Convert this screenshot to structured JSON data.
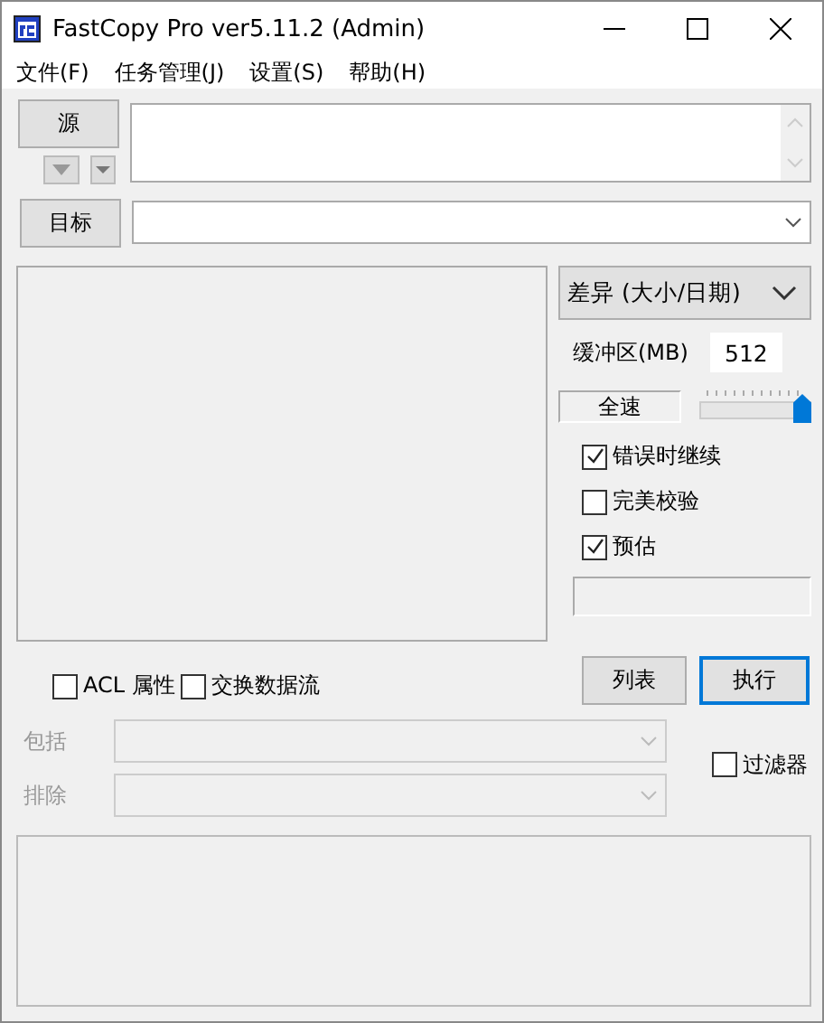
{
  "window": {
    "title": "FastCopy Pro ver5.11.2 (Admin)"
  },
  "menu": [
    "文件(F)",
    "任务管理(J)",
    "设置(S)",
    "帮助(H)"
  ],
  "source": {
    "button": "源"
  },
  "target": {
    "button": "目标"
  },
  "mode": {
    "value": "差异 (大小/日期)"
  },
  "buffer": {
    "label": "缓冲区(MB)",
    "value": "512"
  },
  "speed": {
    "label": "全速",
    "level": 1.0
  },
  "options": [
    {
      "label": "错误时继续",
      "checked": true
    },
    {
      "label": "完美校验",
      "checked": false
    },
    {
      "label": "预估",
      "checked": true
    }
  ],
  "attr_options": [
    {
      "label": "ACL 属性",
      "checked": false
    },
    {
      "label": "交换数据流",
      "checked": false
    }
  ],
  "buttons": [
    {
      "label": "列表",
      "selected": false
    },
    {
      "label": "执行",
      "selected": true
    }
  ],
  "filters": [
    {
      "label": "包括",
      "disabled": true
    },
    {
      "label": "排除",
      "disabled": true
    }
  ],
  "filter_toggle": {
    "label": "过滤器",
    "checked": false
  }
}
